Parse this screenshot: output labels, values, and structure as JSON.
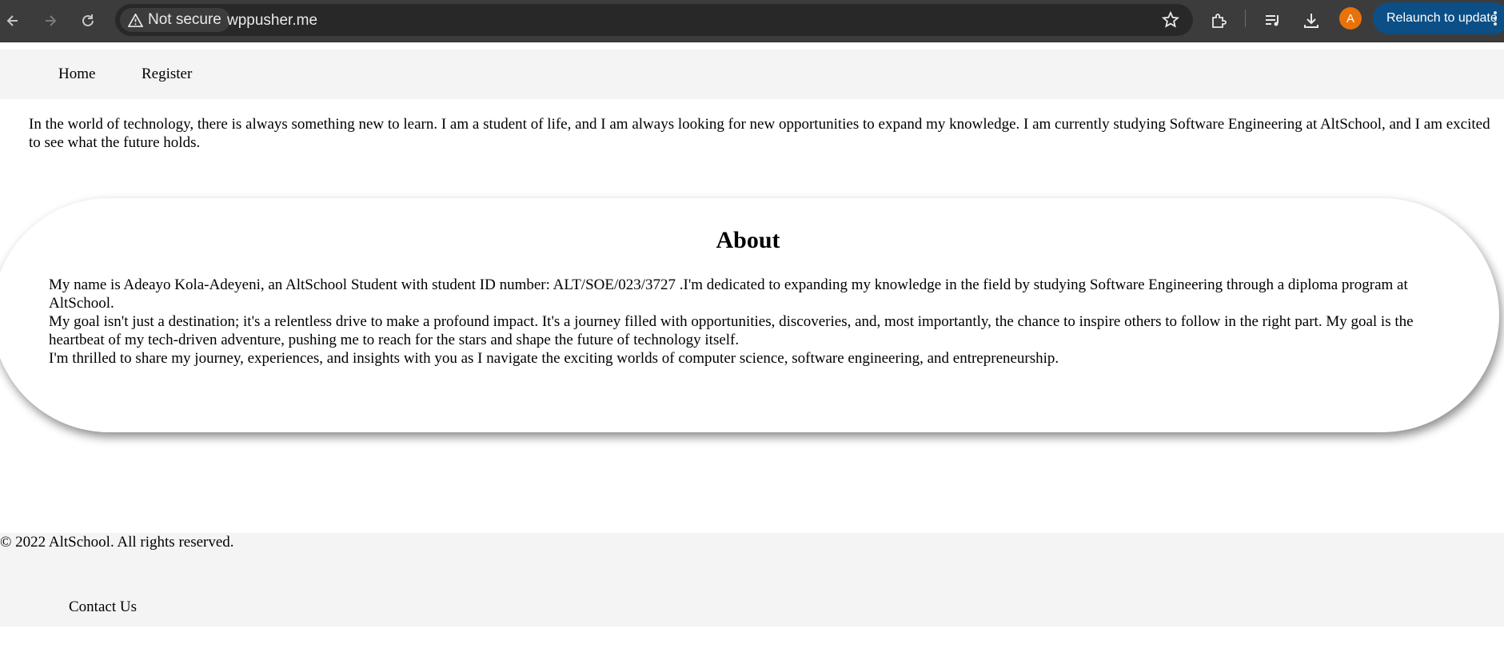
{
  "browser": {
    "security_label": "Not secure",
    "url": "wppusher.me",
    "profile_initial": "A",
    "relaunch_label": "Relaunch to update",
    "accent_color": "#0b4f86",
    "avatar_color": "#e8710a"
  },
  "nav": {
    "links": [
      {
        "label": "Home"
      },
      {
        "label": "Register"
      }
    ]
  },
  "intro": {
    "text": "In the world of technology, there is always something new to learn. I am a student of life, and I am always looking for new opportunities to expand my knowledge. I am currently studying Software Engineering at AltSchool, and I am excited to see what the future holds."
  },
  "about": {
    "title": "About",
    "paragraphs": [
      "My name is Adeayo Kola-Adeyeni, an AltSchool Student with student ID number: ALT/SOE/023/3727 .I'm dedicated to expanding my knowledge in the field by studying Software Engineering through a diploma program at AltSchool.",
      "My goal isn't just a destination; it's a relentless drive to make a profound impact. It's a journey filled with opportunities, discoveries, and, most importantly, the chance to inspire others to follow in the right part. My goal is the heartbeat of my tech-driven adventure, pushing me to reach for the stars and shape the future of technology itself.",
      "I'm thrilled to share my journey, experiences, and insights with you as I navigate the exciting worlds of computer science, software engineering, and entrepreneurship."
    ]
  },
  "footer": {
    "copyright": "© 2022 AltSchool. All rights reserved.",
    "contact_label": "Contact Us"
  }
}
